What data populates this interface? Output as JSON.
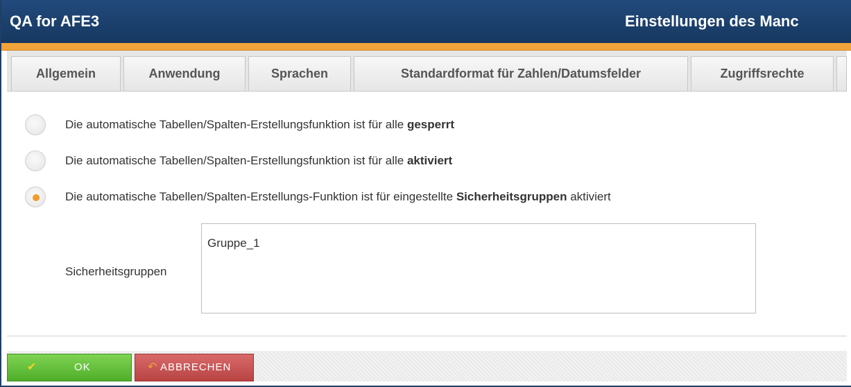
{
  "window": {
    "app_title": "QA for AFE3",
    "dialog_title": "Einstellungen des Manc"
  },
  "tabs": [
    {
      "label": "Allgemein"
    },
    {
      "label": "Anwendung"
    },
    {
      "label": "Sprachen"
    },
    {
      "label": "Standardformat für Zahlen/Datumsfelder"
    },
    {
      "label": "Zugriffsrechte"
    }
  ],
  "options": [
    {
      "prefix": "Die automatische Tabellen/Spalten-Erstellungsfunktion ist für alle ",
      "bold": "gesperrt",
      "suffix": "",
      "selected": false
    },
    {
      "prefix": "Die automatische Tabellen/Spalten-Erstellungsfunktion ist für alle ",
      "bold": "aktiviert",
      "suffix": "",
      "selected": false
    },
    {
      "prefix": "Die automatische Tabellen/Spalten-Erstellungs-Funktion ist für eingestellte ",
      "bold": "Sicherheitsgruppen",
      "suffix": " aktiviert",
      "selected": true
    }
  ],
  "security_groups": {
    "label": "Sicherheitsgruppen",
    "items": [
      "Gruppe_1"
    ]
  },
  "buttons": {
    "ok_label": "OK",
    "cancel_label": "ABBRECHEN"
  },
  "icons": {
    "ok": "checkmark-icon",
    "cancel": "undo-arrow-icon"
  },
  "colors": {
    "titlebar": "#1c4270",
    "accent_orange": "#f2a33a",
    "ok_green": "#5cbf34",
    "cancel_red": "#c65050"
  }
}
